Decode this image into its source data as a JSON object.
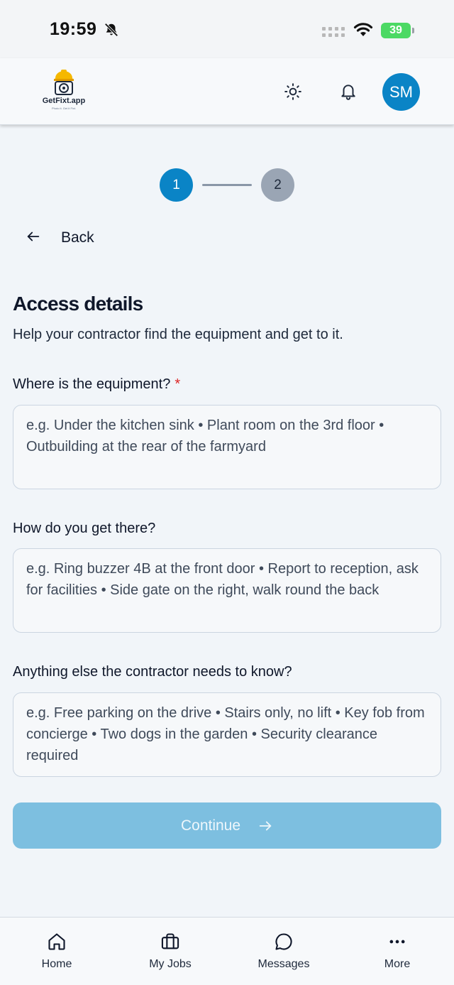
{
  "status_bar": {
    "time": "19:59",
    "battery": "39"
  },
  "header": {
    "logo_text": "GetFixt.app",
    "logo_tagline": "Photo it. Get it Fixt.",
    "avatar_initials": "SM",
    "icons": [
      "sun-icon",
      "bell-icon"
    ]
  },
  "stepper": {
    "steps": [
      "1",
      "2"
    ],
    "current": 1
  },
  "nav": {
    "back_label": "Back"
  },
  "form": {
    "title": "Access details",
    "subtitle": "Help your contractor find the equipment and get to it.",
    "fields": [
      {
        "label": "Where is the equipment?",
        "required_marker": "*",
        "value": "",
        "placeholder": "e.g. Under the kitchen sink • Plant room on the 3rd floor • Outbuilding at the rear of the farmyard"
      },
      {
        "label": "How do you get there?",
        "value": "",
        "placeholder": "e.g. Ring buzzer 4B at the front door • Report to reception, ask for facilities • Side gate on the right, walk round the back"
      },
      {
        "label": "Anything else the contractor needs to know?",
        "value": "",
        "placeholder": "e.g. Free parking on the drive • Stairs only, no lift • Key fob from concierge • Two dogs in the garden • Security clearance required"
      }
    ],
    "continue_label": "Continue"
  },
  "colors": {
    "primary": "#0a84c6",
    "continue_disabled": "#7dbfe0",
    "step_inactive": "#9aa5b4",
    "required": "#dc2626"
  },
  "tab_bar": {
    "items": [
      {
        "label": "Home",
        "icon": "home-icon"
      },
      {
        "label": "My Jobs",
        "icon": "briefcase-icon"
      },
      {
        "label": "Messages",
        "icon": "chat-icon"
      },
      {
        "label": "More",
        "icon": "more-icon"
      }
    ]
  }
}
